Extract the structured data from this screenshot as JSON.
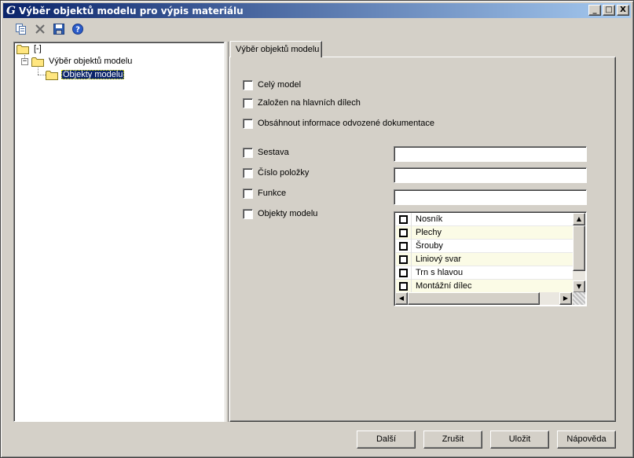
{
  "window": {
    "title": "Výběr objektů modelu pro výpis materiálu",
    "app_icon_glyph": "G",
    "controls": {
      "minimize": "_",
      "maximize": "□",
      "close": "X"
    }
  },
  "toolbar": {
    "items": [
      {
        "name": "copy-icon"
      },
      {
        "name": "delete-icon"
      },
      {
        "name": "save-icon"
      },
      {
        "name": "help-icon"
      }
    ]
  },
  "tree": {
    "root": "[-]",
    "node": "Výběr objektů modelu",
    "child": "Objekty modelu",
    "expander_symbol": "−"
  },
  "tab": {
    "label": "Výběr objektů modelu"
  },
  "options": {
    "whole_model": "Celý model",
    "based_on_main_parts": "Založen na hlavních dílech",
    "include_derived_doc": "Obsáhnout informace odvozené dokumentace",
    "assembly": "Sestava",
    "item_number": "Číslo položky",
    "function": "Funkce",
    "model_objects": "Objekty modelu"
  },
  "fields": {
    "assembly_value": "",
    "item_number_value": "",
    "function_value": ""
  },
  "object_list": [
    "Nosník",
    "Plechy",
    "Šrouby",
    "Liniový svar",
    "Trn s hlavou",
    "Montážní dílec"
  ],
  "scroll_glyphs": {
    "up": "▲",
    "down": "▼",
    "left": "◀",
    "right": "▶"
  },
  "buttons": {
    "next": "Další",
    "cancel": "Zrušit",
    "save": "Uložit",
    "help": "Nápověda"
  },
  "colors": {
    "title_start": "#0a246a",
    "title_end": "#a6caf0",
    "face": "#d4d0c8",
    "selection": "#0a246a"
  }
}
